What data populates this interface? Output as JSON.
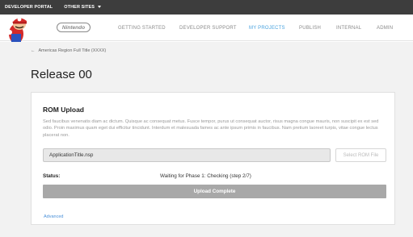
{
  "topbar": {
    "portal": "DEVELOPER PORTAL",
    "other_sites": "OTHER SITES"
  },
  "nav": {
    "logo": "Nintendo",
    "items": [
      "GETTING STARTED",
      "DEVELOPER SUPPORT",
      "MY PROJECTS",
      "PUBLISH",
      "INTERNAL",
      "ADMIN"
    ],
    "active_item": "MY PROJECTS"
  },
  "breadcrumb": {
    "text": "Americas Region Full Title (XXXX)"
  },
  "page": {
    "title": "Release 00"
  },
  "rom_upload": {
    "title": "ROM Upload",
    "description": "Sed faucibus venenatis diam ac dictum. Quisque ac consequat metus. Fusce tempor, purus ut consequat auctor, risus magna congue mauris, non suscipit ex est sed odio. Proin maximus quam eget dui efficitur tincidunt. Interdum et malesuada fames ac ante ipsum primis in faucibus. Nam pretium laoreet turpis, vitae congue lectus placerat non.",
    "file_name": "ApplicationTitle.nsp",
    "select_button": "Select ROM File",
    "status_label": "Status:",
    "status_text": "Waiting for Phase 1: Checking  (step 2/7)",
    "upload_button": "Upload Complete",
    "advanced_link": "Advanced"
  },
  "colors": {
    "topbar_bg": "#3d3d3d",
    "accent": "#4aa3df",
    "upload_bar": "#a8a8a8",
    "link": "#4a90d9"
  }
}
